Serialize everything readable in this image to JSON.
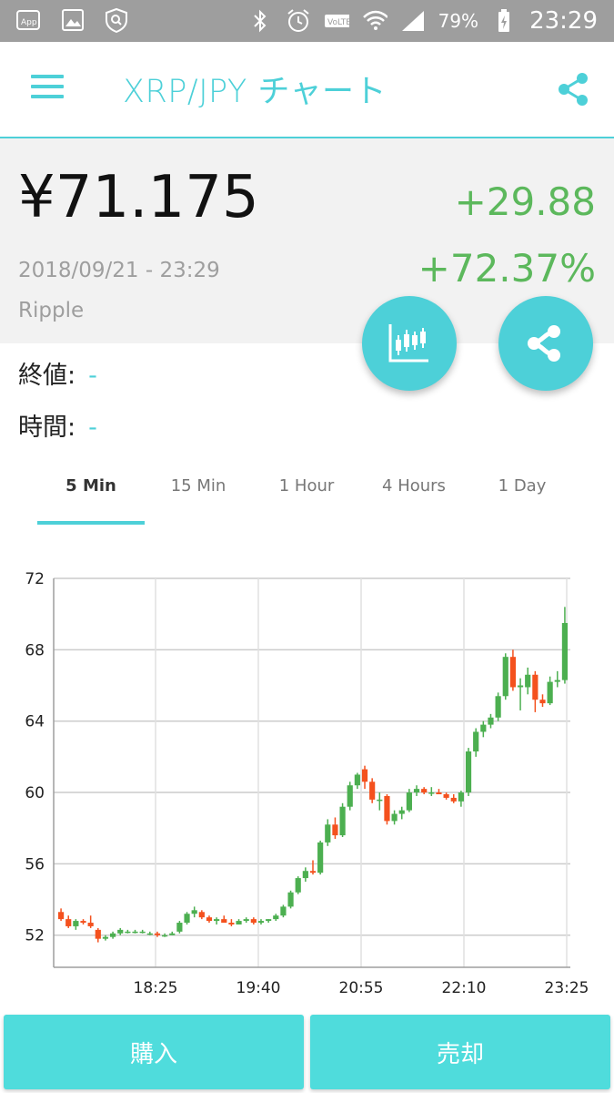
{
  "status_bar": {
    "battery": "79%",
    "time": "23:29",
    "icons": [
      "app-icon",
      "image-icon",
      "shield-icon",
      "bluetooth-icon",
      "alarm-icon",
      "volte-icon",
      "wifi-icon",
      "signal-icon",
      "battery-icon"
    ]
  },
  "app_bar": {
    "title": "XRP/JPY チャート"
  },
  "price_panel": {
    "price": "¥71.175",
    "change": "+29.88",
    "change_pct": "+72.37%",
    "datetime": "2018/09/21 - 23:29",
    "coin": "Ripple"
  },
  "info": {
    "close_label": "終値:",
    "close_value": "-",
    "time_label": "時間:",
    "time_value": "-"
  },
  "tabs": [
    {
      "label": "5 Min",
      "active": true
    },
    {
      "label": "15 Min",
      "active": false
    },
    {
      "label": "1 Hour",
      "active": false
    },
    {
      "label": "4 Hours",
      "active": false
    },
    {
      "label": "1 Day",
      "active": false
    }
  ],
  "colors": {
    "accent": "#4dd0d8",
    "up": "#4caf50",
    "down": "#f4511e",
    "positive_text": "#5cb85c"
  },
  "chart_data": {
    "type": "candlestick",
    "xlabels": [
      "18:25",
      "19:40",
      "20:55",
      "22:10",
      "23:25"
    ],
    "ylabels": [
      "52",
      "56",
      "60",
      "64",
      "68",
      "72"
    ],
    "ylim": [
      50.2,
      72
    ],
    "grid": true,
    "candles": [
      [
        53.3,
        53.5,
        52.8,
        52.9
      ],
      [
        52.9,
        53.1,
        52.4,
        52.5
      ],
      [
        52.5,
        52.9,
        52.3,
        52.8
      ],
      [
        52.8,
        52.9,
        52.6,
        52.7
      ],
      [
        52.7,
        53.1,
        52.4,
        52.5
      ],
      [
        52.3,
        52.4,
        51.6,
        51.8
      ],
      [
        51.8,
        52.0,
        51.7,
        51.9
      ],
      [
        51.9,
        52.2,
        51.8,
        52.1
      ],
      [
        52.1,
        52.4,
        52.0,
        52.3
      ],
      [
        52.2,
        52.3,
        52.1,
        52.2
      ],
      [
        52.2,
        52.3,
        52.1,
        52.2
      ],
      [
        52.2,
        52.3,
        52.1,
        52.2
      ],
      [
        52.1,
        52.2,
        52.0,
        52.1
      ],
      [
        52.1,
        52.2,
        51.9,
        52.0
      ],
      [
        52.0,
        52.1,
        51.9,
        52.0
      ],
      [
        52.0,
        52.2,
        52.0,
        52.1
      ],
      [
        52.2,
        52.8,
        52.1,
        52.7
      ],
      [
        52.7,
        53.3,
        52.6,
        53.2
      ],
      [
        53.2,
        53.6,
        53.0,
        53.4
      ],
      [
        53.3,
        53.4,
        52.9,
        53.0
      ],
      [
        53.0,
        53.1,
        52.7,
        52.8
      ],
      [
        52.8,
        53.0,
        52.6,
        52.9
      ],
      [
        52.9,
        53.1,
        52.7,
        52.7
      ],
      [
        52.7,
        52.9,
        52.5,
        52.6
      ],
      [
        52.6,
        52.9,
        52.6,
        52.8
      ],
      [
        52.8,
        53.0,
        52.7,
        52.9
      ],
      [
        52.9,
        53.0,
        52.6,
        52.7
      ],
      [
        52.7,
        52.9,
        52.6,
        52.8
      ],
      [
        52.8,
        52.9,
        52.7,
        52.9
      ],
      [
        52.9,
        53.2,
        52.8,
        53.1
      ],
      [
        53.1,
        53.7,
        53.0,
        53.6
      ],
      [
        53.6,
        54.5,
        53.5,
        54.4
      ],
      [
        54.4,
        55.3,
        54.3,
        55.2
      ],
      [
        55.2,
        55.8,
        55.0,
        55.6
      ],
      [
        55.6,
        56.2,
        55.4,
        55.5
      ],
      [
        55.5,
        57.3,
        55.4,
        57.2
      ],
      [
        57.2,
        58.5,
        57.0,
        58.2
      ],
      [
        58.2,
        58.6,
        57.4,
        57.6
      ],
      [
        57.6,
        59.4,
        57.5,
        59.2
      ],
      [
        59.2,
        60.6,
        59.0,
        60.4
      ],
      [
        60.4,
        61.1,
        60.2,
        61.0
      ],
      [
        61.3,
        61.5,
        60.2,
        60.6
      ],
      [
        60.6,
        60.8,
        59.4,
        59.6
      ],
      [
        59.6,
        60.0,
        59.0,
        59.6
      ],
      [
        59.8,
        59.9,
        58.2,
        58.4
      ],
      [
        58.4,
        59.0,
        58.2,
        58.8
      ],
      [
        58.8,
        59.2,
        58.5,
        59.0
      ],
      [
        59.0,
        60.2,
        58.9,
        60.0
      ],
      [
        60.0,
        60.4,
        59.8,
        60.2
      ],
      [
        60.2,
        60.3,
        59.9,
        60.0
      ],
      [
        60.0,
        60.3,
        59.8,
        60.0
      ],
      [
        60.0,
        60.2,
        59.9,
        59.9
      ],
      [
        59.9,
        60.0,
        59.6,
        59.7
      ],
      [
        59.7,
        59.9,
        59.4,
        59.5
      ],
      [
        59.5,
        60.1,
        59.2,
        60.0
      ],
      [
        60.0,
        62.5,
        59.8,
        62.3
      ],
      [
        62.3,
        63.6,
        62.0,
        63.4
      ],
      [
        63.4,
        64.0,
        63.1,
        63.8
      ],
      [
        63.8,
        64.4,
        63.6,
        64.2
      ],
      [
        64.2,
        65.6,
        64.0,
        65.4
      ],
      [
        65.4,
        67.8,
        65.2,
        67.6
      ],
      [
        67.6,
        68.0,
        65.7,
        65.9
      ],
      [
        65.9,
        66.4,
        64.6,
        66.0
      ],
      [
        65.9,
        67.0,
        65.5,
        66.6
      ],
      [
        66.6,
        66.8,
        64.5,
        65.2
      ],
      [
        65.2,
        65.5,
        64.8,
        65.0
      ],
      [
        65.0,
        66.5,
        64.9,
        66.2
      ],
      [
        66.2,
        66.8,
        65.9,
        66.3
      ],
      [
        66.3,
        70.4,
        66.1,
        69.5
      ]
    ]
  }
}
